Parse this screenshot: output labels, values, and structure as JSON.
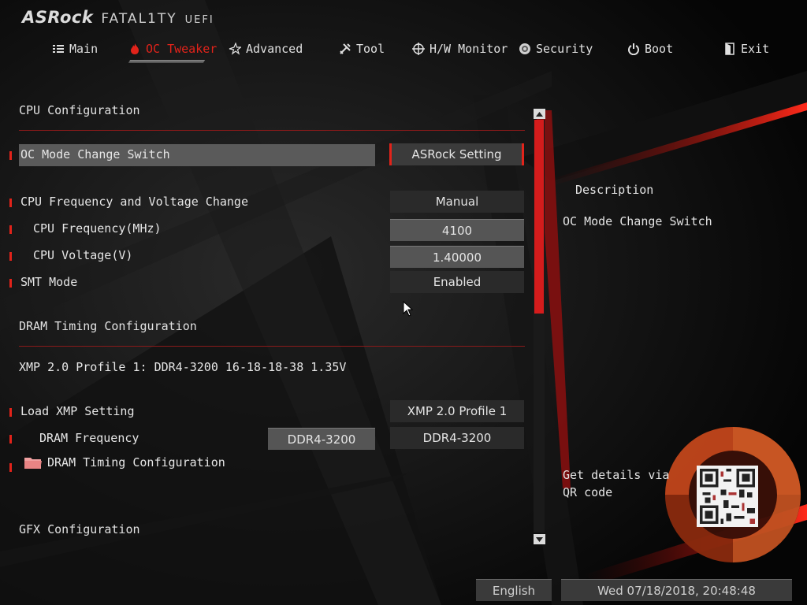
{
  "header": {
    "brand": "ASRock",
    "product": "FATAL1TY",
    "suffix": "UEFI"
  },
  "tabs": [
    {
      "label": "Main",
      "icon": "list-icon",
      "active": false
    },
    {
      "label": "OC Tweaker",
      "icon": "flame-icon",
      "active": true
    },
    {
      "label": "Advanced",
      "icon": "star-icon",
      "active": false
    },
    {
      "label": "Tool",
      "icon": "tools-icon",
      "active": false
    },
    {
      "label": "H/W Monitor",
      "icon": "crosshair-icon",
      "active": false
    },
    {
      "label": "Security",
      "icon": "shield-icon",
      "active": false
    },
    {
      "label": "Boot",
      "icon": "power-icon",
      "active": false
    },
    {
      "label": "Exit",
      "icon": "exit-icon",
      "active": false
    }
  ],
  "content": {
    "cpu_section": "CPU Configuration",
    "oc_mode_label": "OC Mode Change Switch",
    "oc_mode_value": "ASRock Setting",
    "cpu_freq_volt_label": "CPU Frequency and Voltage Change",
    "cpu_freq_volt_value": "Manual",
    "cpu_freq_label": "CPU Frequency(MHz)",
    "cpu_freq_value": "4100",
    "cpu_volt_label": "CPU Voltage(V)",
    "cpu_volt_value": "1.40000",
    "smt_label": "SMT Mode",
    "smt_value": "Enabled",
    "dram_section": "DRAM Timing Configuration",
    "xmp_info": "XMP 2.0 Profile 1: DDR4-3200 16-18-18-38 1.35V",
    "load_xmp_label": "Load XMP Setting",
    "load_xmp_value": "XMP 2.0 Profile 1",
    "dram_freq_label": "DRAM Frequency",
    "dram_freq_current": "DDR4-3200",
    "dram_freq_value": "DDR4-3200",
    "dram_timing_folder": "DRAM Timing Configuration",
    "gfx_section": "GFX Configuration"
  },
  "sidebar": {
    "description_title": "Description",
    "description_text": "OC Mode Change Switch",
    "qr_text": "Get details via QR code"
  },
  "footer": {
    "language": "English",
    "datetime": "Wed 07/18/2018, 20:48:48"
  },
  "colors": {
    "accent": "#e2231a",
    "background": "#070707",
    "highlight": "#5a5a5a"
  }
}
